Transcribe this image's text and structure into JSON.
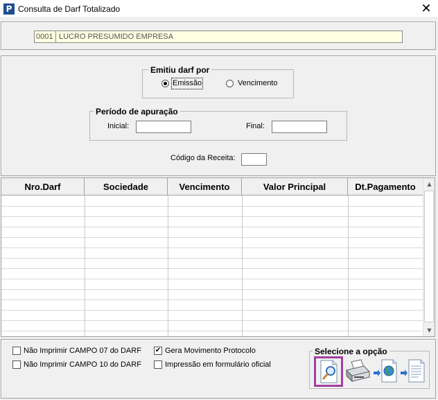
{
  "window": {
    "title": "Consulta de Darf Totalizado",
    "close_glyph": "✕",
    "app_icon_letter": "P"
  },
  "company": {
    "code": "0001",
    "name": "LUCRO PRESUMIDO EMPRESA"
  },
  "emitiu": {
    "title": "Emitiu darf por",
    "options": [
      {
        "label": "Emissão",
        "selected": true
      },
      {
        "label": "Vencimento",
        "selected": false
      }
    ]
  },
  "periodo": {
    "title": "Período de apuração",
    "inicial_label": "Inicial:",
    "inicial_value": "",
    "final_label": "Final:",
    "final_value": ""
  },
  "codigo_receita": {
    "label": "Código da Receita:",
    "value": ""
  },
  "table": {
    "columns": [
      "Nro.Darf",
      "Sociedade",
      "Vencimento",
      "Valor Principal",
      "Dt.Pagamento"
    ],
    "rows": []
  },
  "options": {
    "checkboxes": [
      {
        "label": "Não Imprimir CAMPO 07 do DARF",
        "checked": false
      },
      {
        "label": "Não Imprimir CAMPO 10 do DARF",
        "checked": false
      },
      {
        "label": "Gera Movimento Protocolo",
        "checked": true
      },
      {
        "label": "Impressão em formulário oficial",
        "checked": false
      }
    ],
    "check_glyph": "✔"
  },
  "actions": {
    "title": "Selecione a opção",
    "buttons": [
      "search-icon",
      "printer-icon",
      "export-web-icon",
      "document-icon"
    ]
  },
  "colors": {
    "selected_button_border": "#a040a0",
    "company_field_bg": "#ffffe1"
  }
}
